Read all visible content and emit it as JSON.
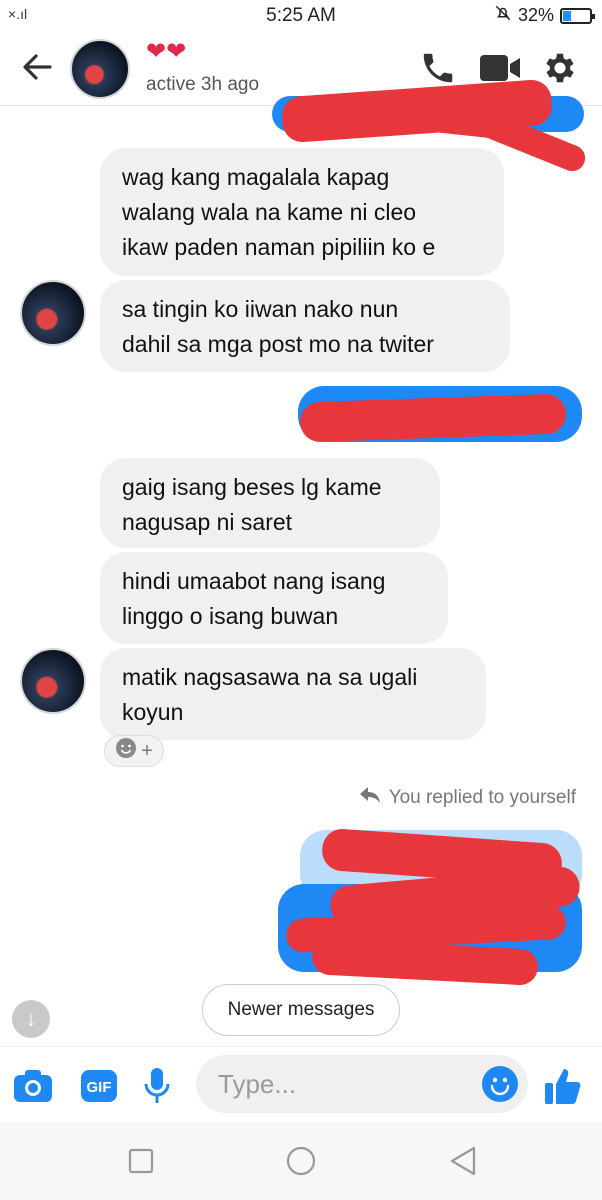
{
  "status_bar": {
    "signal": "×.ıl",
    "time": "5:25 AM",
    "battery": "32%",
    "battery_level": 0.32
  },
  "header": {
    "back_icon": "arrow-left-icon",
    "status": "active 3h ago",
    "hearts": "❤❤",
    "actions": [
      "phone-icon",
      "video-camera-icon",
      "gear-icon"
    ]
  },
  "messages": [
    {
      "from": "them",
      "text": "wag kang magalala kapag\nwalang wala na kame ni cleo\nikaw paden naman pipiliin ko e"
    },
    {
      "from": "them",
      "text": "sa tingin ko iiwan nako nun\ndahil sa mga post mo na twiter"
    },
    {
      "from": "them",
      "text": "gaig isang beses lg kame\nnagusap ni saret"
    },
    {
      "from": "them",
      "text": "hindi umaabot nang isang\nlinggo o isang buwan"
    },
    {
      "from": "them",
      "text": "matik nagsasawa na sa ugali\nkoyun"
    }
  ],
  "replied_note": "You replied to yourself",
  "newer_messages": "Newer messages",
  "composer": {
    "placeholder": "Type...",
    "gif_label": "GIF",
    "icons": [
      "camera-icon",
      "gif-icon",
      "microphone-icon",
      "emoji-icon",
      "thumbs-up-icon"
    ]
  },
  "colors": {
    "accent": "#1e88f5",
    "bubble_gray": "#f0f0f0",
    "redaction": "#e8373c"
  }
}
